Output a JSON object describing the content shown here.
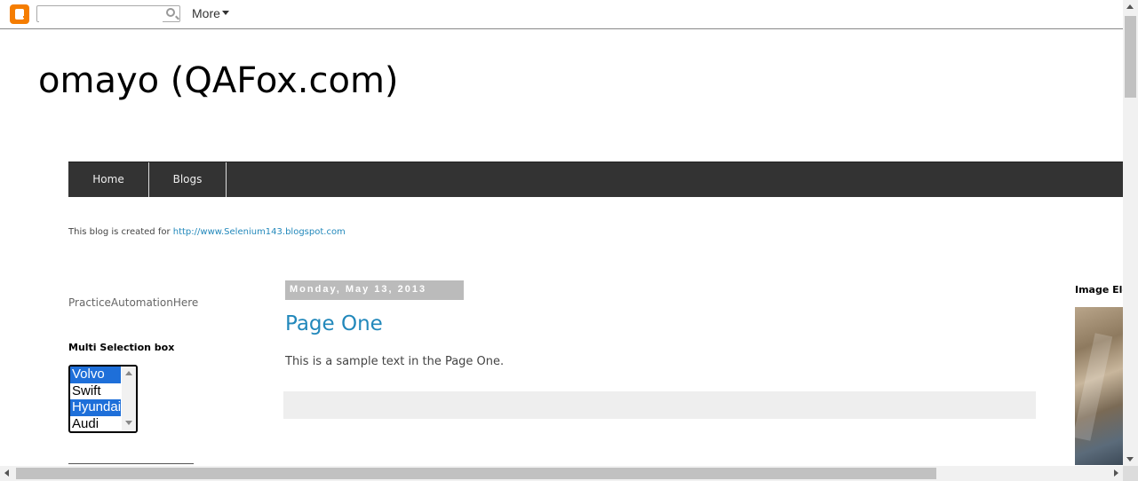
{
  "navbar": {
    "logo_icon": "blogger-logo-icon",
    "search": {
      "value": "",
      "placeholder": ""
    },
    "more_label": "More"
  },
  "header": {
    "title": "omayo (QAFox.com)"
  },
  "tabs": [
    {
      "label": "Home"
    },
    {
      "label": "Blogs"
    }
  ],
  "description": {
    "text": "This blog is created for ",
    "link_text": "http://www.Selenium143.blogspot.com"
  },
  "sidebar_left": {
    "practice_text": "PracticeAutomationHere",
    "multi_select": {
      "title": "Multi Selection box",
      "options": [
        {
          "label": "Volvo",
          "selected": true
        },
        {
          "label": "Swift",
          "selected": false
        },
        {
          "label": "Hyundai",
          "selected": true
        },
        {
          "label": "Audi",
          "selected": false
        }
      ]
    }
  },
  "post": {
    "date": "Monday, May 13, 2013",
    "title": "Page One",
    "body": "This is a sample text in the Page One."
  },
  "sidebar_right": {
    "image_title": "Image Element"
  },
  "colors": {
    "link": "#2288bb",
    "tabs_bg": "#333333",
    "date_bg": "#bbbbbb",
    "selection": "#1e6fd9",
    "logo": "#f57d00"
  }
}
